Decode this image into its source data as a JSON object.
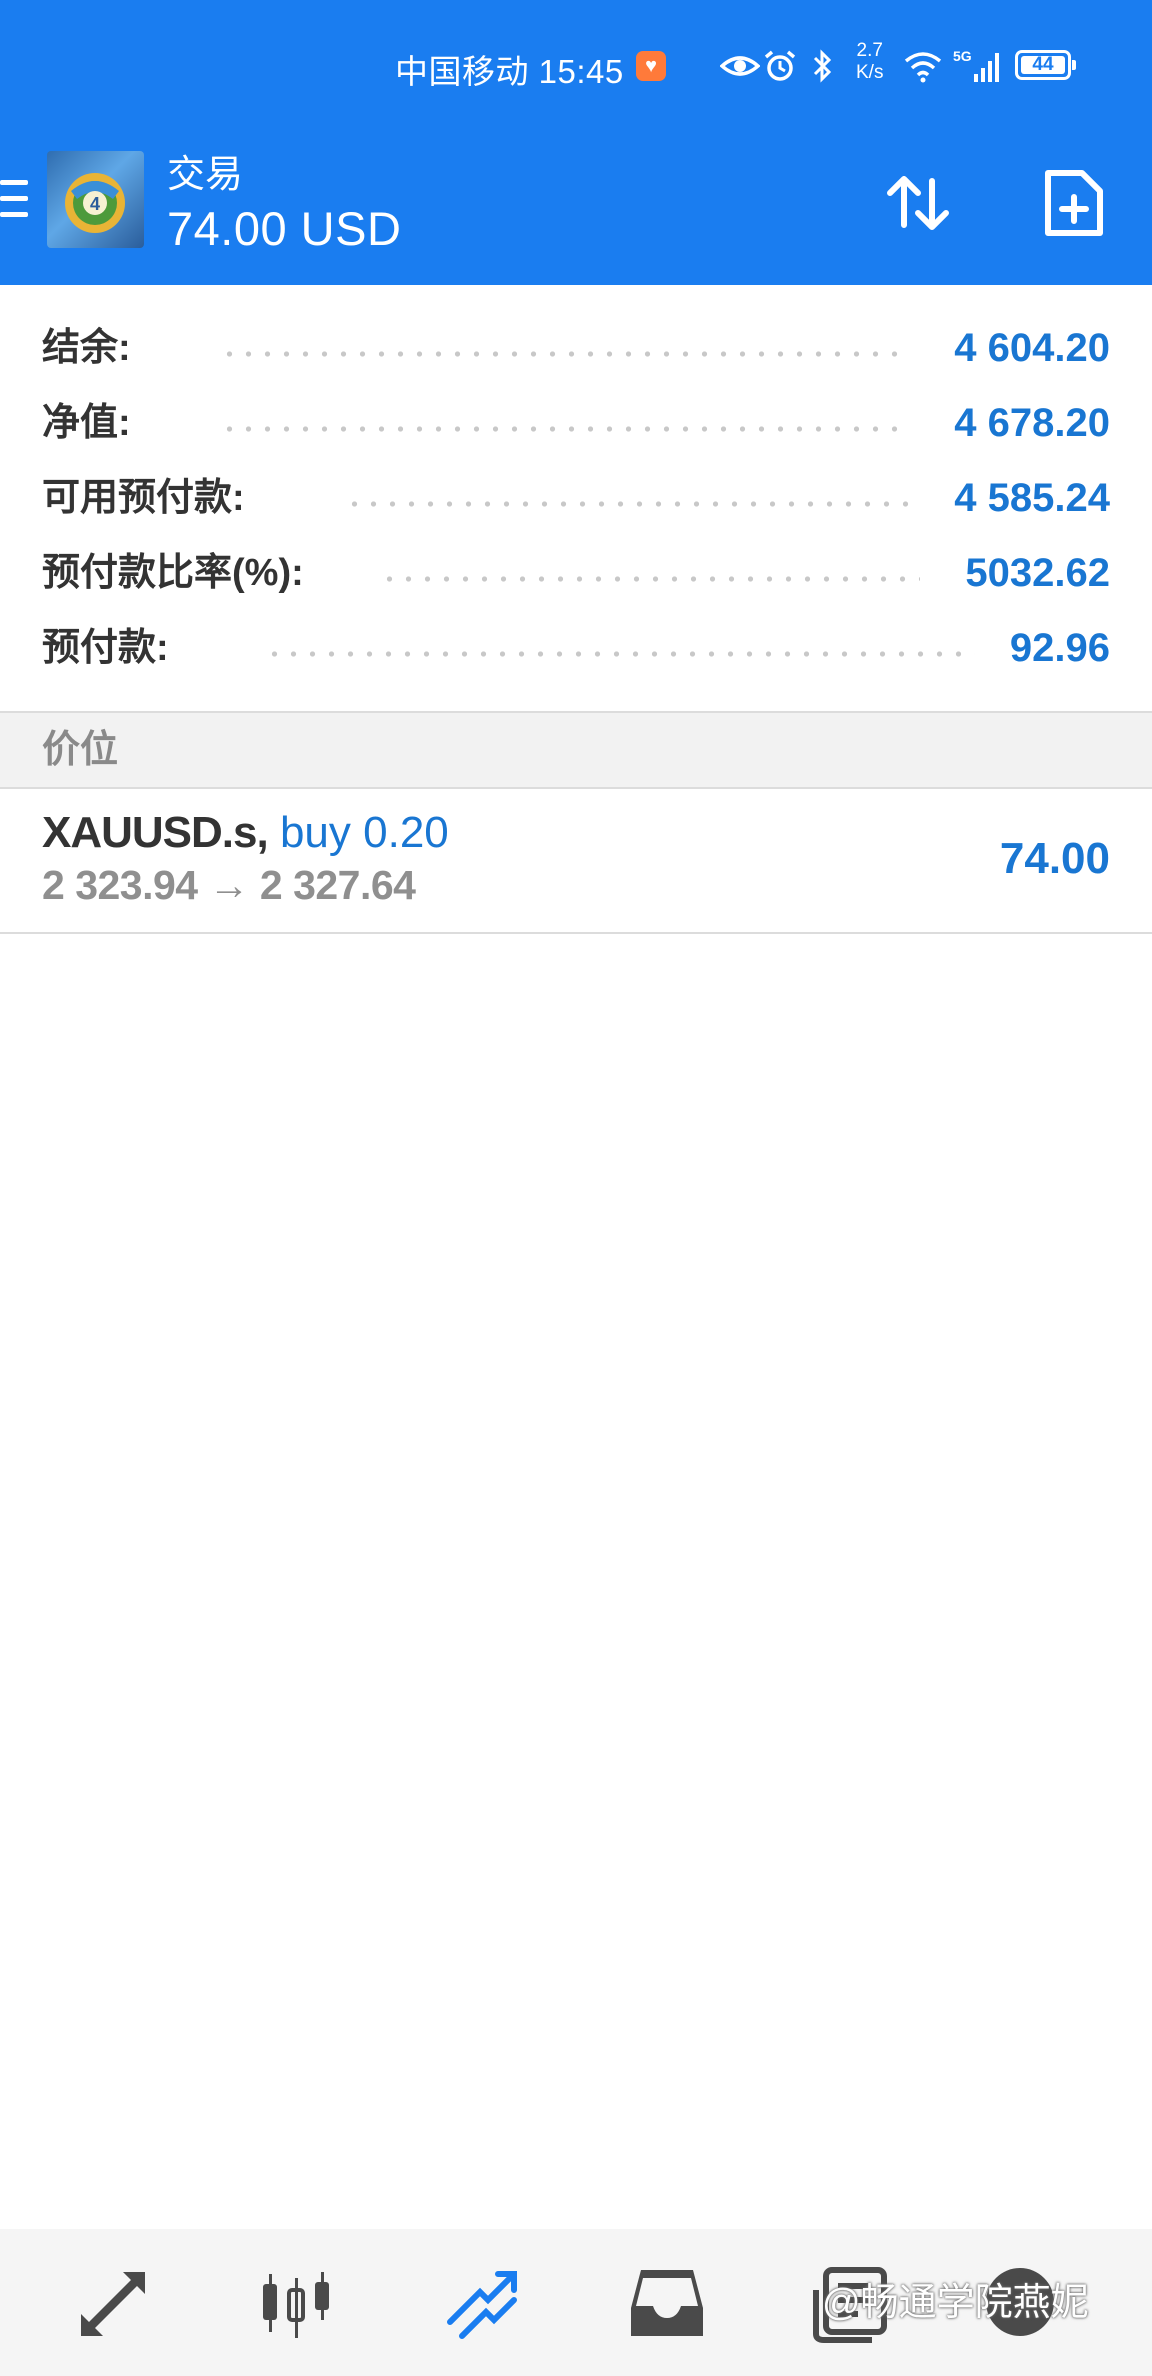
{
  "status_bar": {
    "carrier_time": "中国移动 15:45",
    "speed_top": "2.7",
    "speed_bottom": "K/s",
    "network": "5G",
    "battery": "44"
  },
  "header": {
    "title": "交易",
    "subtitle": "74.00 USD"
  },
  "summary": [
    {
      "label": "结余:",
      "value": "4 604.20"
    },
    {
      "label": "净值:",
      "value": "4 678.20"
    },
    {
      "label": "可用预付款:",
      "value": "4 585.24"
    },
    {
      "label": "预付款比率(%):",
      "value": "5032.62"
    },
    {
      "label": "预付款:",
      "value": "92.96"
    }
  ],
  "section": {
    "title": "价位"
  },
  "positions": [
    {
      "symbol": "XAUUSD.s,",
      "side": "buy 0.20",
      "prices": "2 323.94 → 2 327.64",
      "profit": "74.00"
    }
  ],
  "bottom_nav": [
    {
      "icon": "quotes-icon"
    },
    {
      "icon": "chart-icon"
    },
    {
      "icon": "trade-icon",
      "active": true
    },
    {
      "icon": "history-icon"
    },
    {
      "icon": "news-icon"
    },
    {
      "icon": "chat-icon"
    }
  ],
  "watermark": "@畅通学院燕妮",
  "colors": {
    "header_bg": "#1a7df0",
    "value_blue": "#1976d2",
    "nav_active": "#1a7df0",
    "nav_inactive": "#4a4a4a"
  }
}
